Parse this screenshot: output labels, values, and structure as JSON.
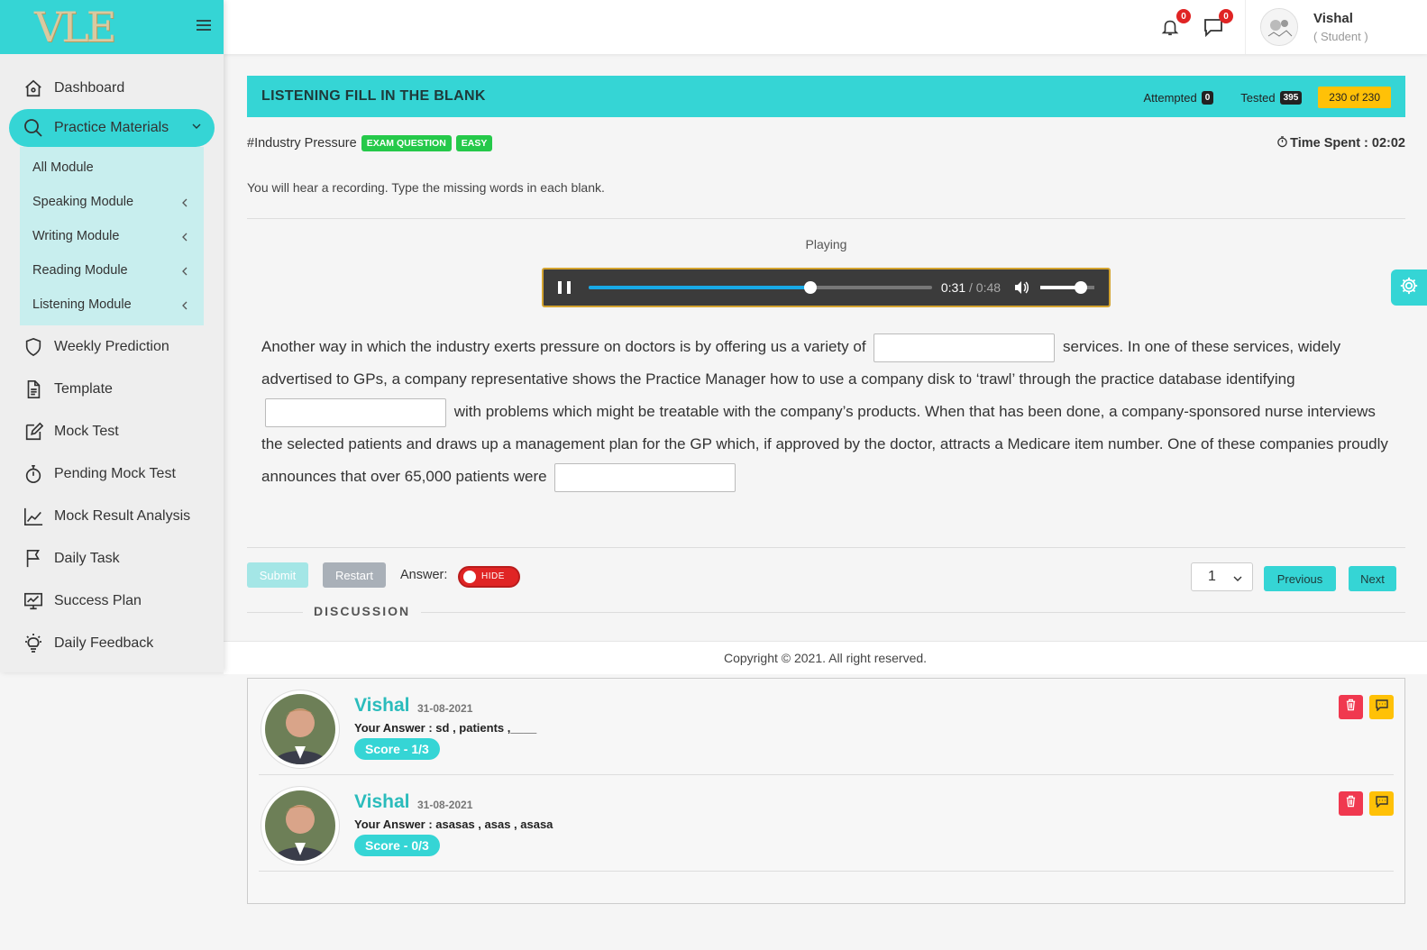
{
  "brand": {
    "logo_text": "VLE"
  },
  "sidebar": {
    "items": [
      {
        "label": "Dashboard",
        "icon": "home-icon"
      },
      {
        "label": "Practice Materials",
        "icon": "search-icon",
        "active": true
      },
      {
        "label": "Weekly Prediction",
        "icon": "shield-icon"
      },
      {
        "label": "Template",
        "icon": "document-icon"
      },
      {
        "label": "Mock Test",
        "icon": "edit-icon"
      },
      {
        "label": "Pending Mock Test",
        "icon": "stopwatch-icon"
      },
      {
        "label": "Mock Result Analysis",
        "icon": "chart-line-icon"
      },
      {
        "label": "Daily Task",
        "icon": "flag-icon"
      },
      {
        "label": "Success Plan",
        "icon": "monitor-icon"
      },
      {
        "label": "Daily Feedback",
        "icon": "lightbulb-icon"
      }
    ],
    "submenu": [
      {
        "label": "All Module"
      },
      {
        "label": "Speaking Module"
      },
      {
        "label": "Writing Module"
      },
      {
        "label": "Reading Module"
      },
      {
        "label": "Listening Module"
      }
    ]
  },
  "header": {
    "notifications_count": "0",
    "messages_count": "0",
    "user_name": "Vishal",
    "user_role": "( Student )"
  },
  "question": {
    "title": "LISTENING FILL IN THE BLANK",
    "attempted_label": "Attempted",
    "attempted_count": "0",
    "tested_label": "Tested",
    "tested_count": "395",
    "counter": "230 of 230",
    "topic": "#Industry Pressure",
    "tags": [
      "EXAM QUESTION",
      "EASY"
    ],
    "time_spent": "Time Spent : 02:02",
    "instruction": "You will hear a recording. Type the missing words in each blank.",
    "player_status": "Playing",
    "audio": {
      "current": "0:31",
      "separator": " / ",
      "duration": "0:48",
      "progress_fraction": 0.646,
      "volume_fraction": 0.75
    },
    "passage": {
      "part1": "Another way in which the industry exerts pressure on doctors is by offering us a variety of",
      "part2": "services. In one of these services, widely advertised to GPs, a company representative shows the Practice Manager how to use a company disk to ‘trawl’ through the practice database identifying",
      "part3": "with problems which might be treatable with the company’s products. When that has been done, a company-sponsored nurse interviews the selected patients and draws up a management plan for the GP which, if approved by the doctor, attracts a Medicare item number. One of these companies proudly announces that over 65,000 patients were"
    }
  },
  "controls": {
    "submit_label": "Submit",
    "restart_label": "Restart",
    "answer_label": "Answer:",
    "toggle_label": "HIDE",
    "page_select": "1",
    "previous_label": "Previous",
    "next_label": "Next"
  },
  "discussion_label": "DISCUSSION",
  "footer": {
    "copyright": "Copyright © 2021. All right reserved."
  },
  "comments": [
    {
      "name": "Vishal",
      "date": "31-08-2021",
      "answer": "Your Answer : sd , patients ,____",
      "score": "Score - 1/3"
    },
    {
      "name": "Vishal",
      "date": "31-08-2021",
      "answer": "Your Answer : asasas , asas , asasa",
      "score": "Score - 0/3"
    }
  ],
  "colors": {
    "accent": "#35d5d5",
    "danger": "#e02424",
    "warning": "#ffc107",
    "tag_green": "#25c94a"
  }
}
